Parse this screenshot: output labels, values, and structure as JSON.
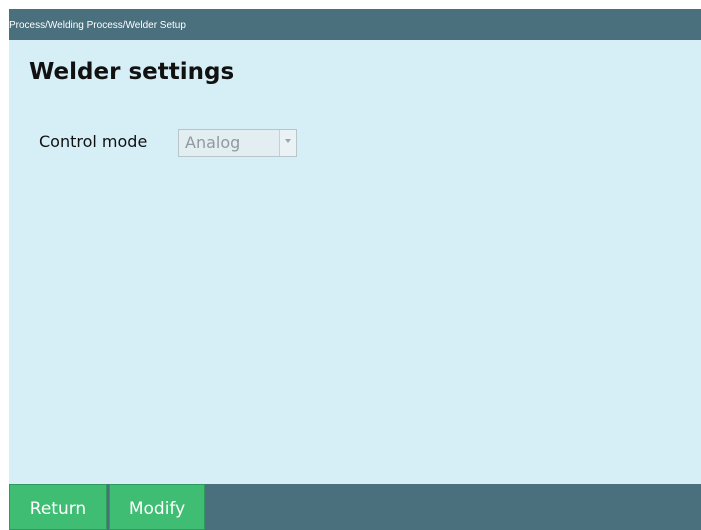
{
  "breadcrumb": "Process/Welding Process/Welder Setup",
  "page": {
    "title": "Welder settings"
  },
  "form": {
    "control_mode": {
      "label": "Control mode",
      "value": "Analog",
      "disabled": true
    }
  },
  "footer": {
    "return_label": "Return",
    "modify_label": "Modify"
  },
  "icons": {
    "dropdown": "chevron-down-icon"
  },
  "colors": {
    "header_bar": "#4a6f7d",
    "background": "#d6eef5",
    "button": "#3fbe73",
    "disabled_text": "#8f9a9e"
  }
}
